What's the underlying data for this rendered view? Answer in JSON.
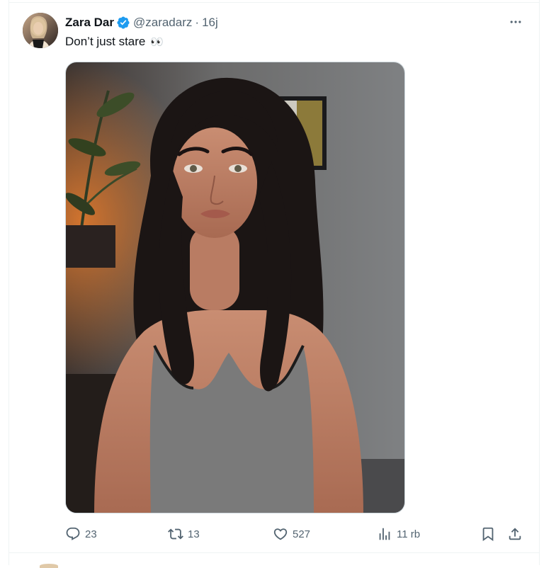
{
  "tweet": {
    "author_name": "Zara Dar",
    "author_handle": "@zaradarz",
    "separator": "·",
    "time": "16j",
    "text": "Don’t just stare",
    "emoji": "👀",
    "verified": true
  },
  "actions": {
    "replies": "23",
    "reposts": "13",
    "likes": "527",
    "views": "11 rb"
  },
  "icons": {
    "reply": "reply-icon",
    "repost": "repost-icon",
    "like": "heart-icon",
    "views": "views-icon",
    "bookmark": "bookmark-icon",
    "share": "share-icon",
    "more": "more-icon",
    "verified": "verified-badge-icon"
  },
  "colors": {
    "verified_blue": "#1d9bf0",
    "secondary_text": "#536471",
    "primary_text": "#0f1419",
    "border": "#eff3f4"
  }
}
